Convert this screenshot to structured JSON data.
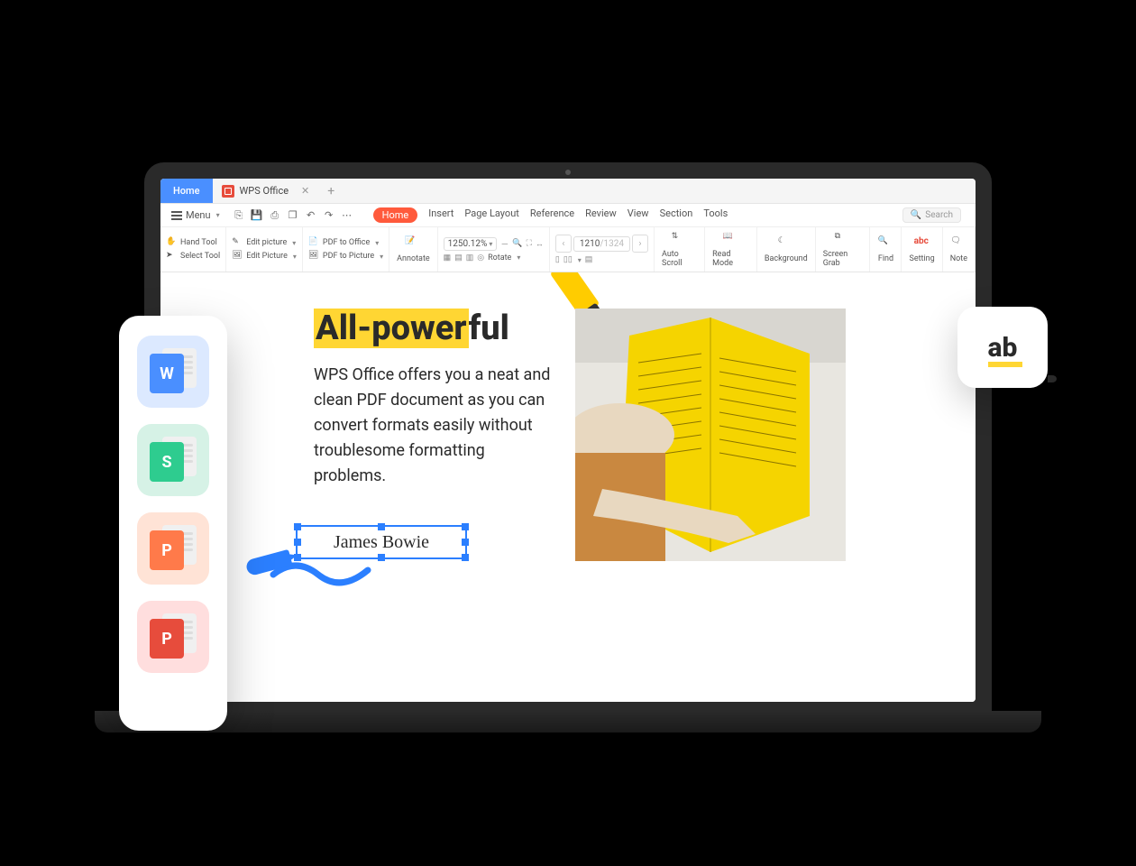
{
  "titlebar": {
    "home_tab": "Home",
    "doc_tab": "WPS Office",
    "close": "✕",
    "add": "+"
  },
  "menubar": {
    "menu_label": "Menu",
    "search_placeholder": "Search"
  },
  "ribbon_tabs": [
    "Home",
    "Insert",
    "Page Layout",
    "Reference",
    "Review",
    "View",
    "Section",
    "Tools"
  ],
  "tools": {
    "hand": "Hand Tool",
    "select": "Select Tool",
    "edit_picture_small": "Edit picture",
    "edit_picture_big": "Edit Picture",
    "pdf_to_office": "PDF to Office",
    "pdf_to_picture": "PDF to Picture",
    "annotate": "Annotate",
    "zoom_value": "1250.12%",
    "rotate": "Rotate",
    "page_current": "1210",
    "page_total": "/1324",
    "auto_scroll": "Auto Scroll",
    "read_mode": "Read Mode",
    "background": "Background",
    "screen_grab": "Screen Grab",
    "find": "Find",
    "setting": "Setting",
    "note": "Note"
  },
  "document": {
    "headline_highlight": "All-power",
    "headline_rest": "ful",
    "body": "WPS Office offers you a neat and clean PDF document as you can convert formats easily without troublesome formatting problems.",
    "signature": "James Bowie"
  },
  "side_apps": {
    "writer": "W",
    "spreadsheet": "S",
    "presentation": "P",
    "pdf": "P"
  },
  "ab_card": "ab"
}
